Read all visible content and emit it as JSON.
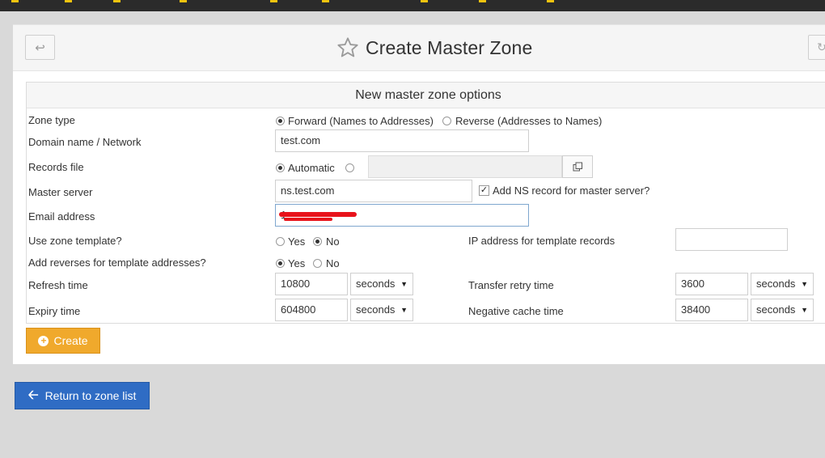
{
  "header": {
    "title": "Create Master Zone"
  },
  "form": {
    "section_title": "New master zone options",
    "zone_type": {
      "label": "Zone type",
      "option_forward": "Forward (Names to Addresses)",
      "option_reverse": "Reverse (Addresses to Names)",
      "selected": "forward"
    },
    "domain": {
      "label": "Domain name / Network",
      "value": "test.com"
    },
    "records_file": {
      "label": "Records file",
      "option_automatic": "Automatic",
      "selected": "automatic",
      "value": ""
    },
    "master_server": {
      "label": "Master server",
      "value": "ns.test.com",
      "add_ns_label": "Add NS record for master server?",
      "add_ns_checked": true
    },
    "email": {
      "label": "Email address",
      "value": "1"
    },
    "use_template": {
      "label": "Use zone template?",
      "option_yes": "Yes",
      "option_no": "No",
      "selected": "no"
    },
    "template_ip": {
      "label": "IP address for template records",
      "value": ""
    },
    "add_reverses": {
      "label": "Add reverses for template addresses?",
      "option_yes": "Yes",
      "option_no": "No",
      "selected": "yes"
    },
    "refresh": {
      "label": "Refresh time",
      "value": "10800",
      "unit": "seconds"
    },
    "transfer_retry": {
      "label": "Transfer retry time",
      "value": "3600",
      "unit": "seconds"
    },
    "expiry": {
      "label": "Expiry time",
      "value": "604800",
      "unit": "seconds"
    },
    "negative_cache": {
      "label": "Negative cache time",
      "value": "38400",
      "unit": "seconds"
    },
    "create_label": "Create"
  },
  "footer": {
    "return_label": "Return to zone list"
  },
  "colors": {
    "create_button": "#f0a92c",
    "return_button": "#2f6cc4",
    "redaction": "#e8131b"
  }
}
